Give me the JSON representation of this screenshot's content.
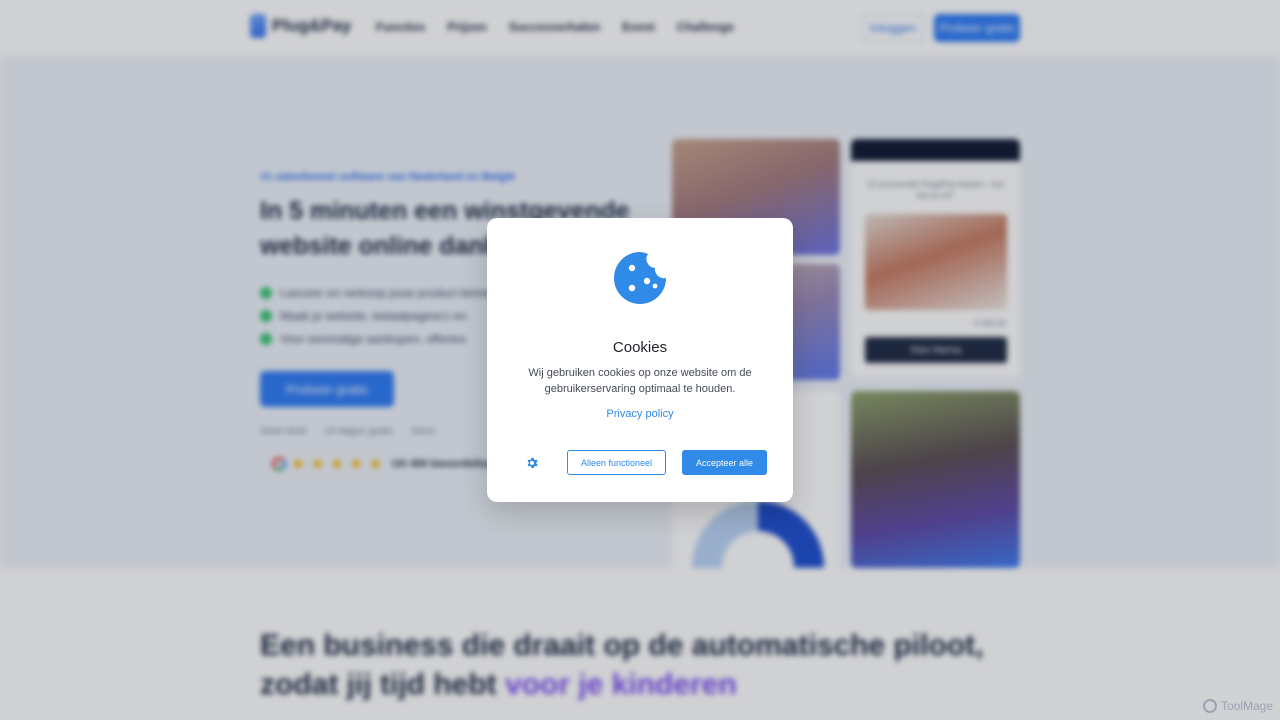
{
  "background": {
    "logo": "Plug&Pay",
    "nav": [
      "Functies",
      "Prijzen",
      "Succesverhalen",
      "Event",
      "Challenge"
    ],
    "login": "Inloggen",
    "trial": "Probeer gratis",
    "eyebrow": "#1 salesfunnel software van Nederland en België",
    "headline": "In 5 minuten een winstgevende website online dankzij",
    "bullets": [
      "Lanceer en verkoop jouw product binnen",
      "Maak je website, betaalpagina's en",
      "Voor eenmalige aankopen, offertes"
    ],
    "hero_cta": "Probeer gratis",
    "checks": [
      "Geen bind",
      "14 dagen gratis",
      "Geen"
    ],
    "rating": "Uit 400 beoordelingen",
    "card_title": "10 succesvolle Plug&Pay klanten - hoe leer je ze?",
    "card_price": "€ 400,00",
    "card_button": "Kies hierna",
    "section_title": "Een business die draait op de automatische piloot,",
    "section_title_line2": "zodat jij tijd hebt",
    "section_title_accent": "voor je kinderen"
  },
  "modal": {
    "title": "Cookies",
    "text": "Wij gebruiken cookies op onze website om de gebruikerservaring optimaal te houden.",
    "privacy_link": "Privacy policy",
    "functional_label": "Alleen functioneel",
    "accept_label": "Accepteer alle"
  },
  "watermark": "ToolMage",
  "colors": {
    "accent": "#2f8ae8",
    "cookie_icon": "#2f8ae8",
    "brand_blue": "#2f7cf6",
    "check_green": "#33c271"
  },
  "icons": {
    "cookie": "cookie-icon",
    "settings": "gear-icon"
  }
}
